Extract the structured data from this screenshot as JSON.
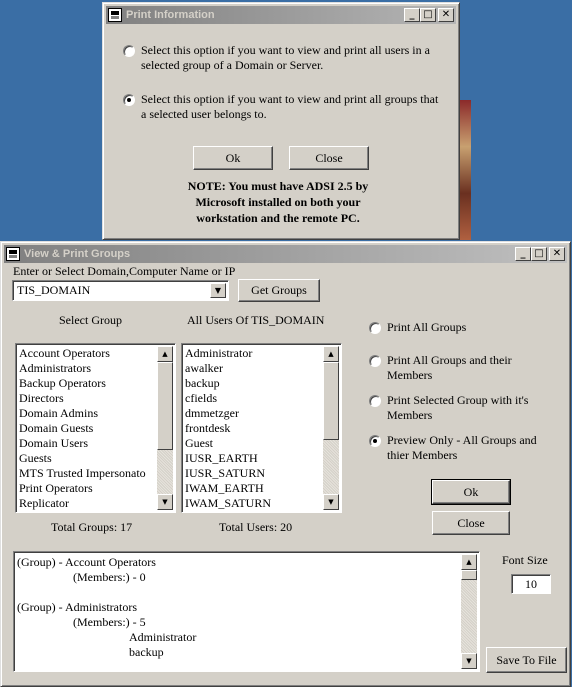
{
  "print_info": {
    "title": "Print Information",
    "option_users": "Select this option if you want to view and print all users in a selected group of a Domain or Server.",
    "option_groups": "Select this option if you want to view and print all groups that a selected user belongs to.",
    "ok_label": "Ok",
    "close_label": "Close",
    "note": "NOTE: You must have ADSI 2.5 by Microsoft installed on both your workstation and the remote PC."
  },
  "main": {
    "title": "View & Print Groups",
    "domain_prompt": "Enter or Select Domain,Computer Name or IP",
    "domain_value": "TIS_DOMAIN",
    "get_groups_label": "Get Groups",
    "select_group_header": "Select Group",
    "all_users_header": "All Users Of TIS_DOMAIN",
    "groups": [
      "Account Operators",
      "Administrators",
      "Backup Operators",
      "Directors",
      "Domain Admins",
      "Domain Guests",
      "Domain Users",
      "Guests",
      "MTS Trusted Impersonato",
      "Print Operators",
      "Replicator"
    ],
    "users": [
      "Administrator",
      "awalker",
      "backup",
      "cfields",
      "dmmetzger",
      "frontdesk",
      "Guest",
      "IUSR_EARTH",
      "IUSR_SATURN",
      "IWAM_EARTH",
      "IWAM_SATURN"
    ],
    "total_groups": "Total Groups: 17",
    "total_users": "Total Users: 20",
    "options": [
      {
        "label": "Print All Groups",
        "checked": false
      },
      {
        "label": "Print All Groups and their Members",
        "checked": false
      },
      {
        "label": "Print Selected Group with it's Members",
        "checked": false
      },
      {
        "label": "Preview Only - All Groups and thier Members",
        "checked": true
      }
    ],
    "ok_label": "Ok",
    "close_label": "Close",
    "font_size_label": "Font Size",
    "font_size_value": "10",
    "save_label": "Save To File",
    "preview_lines": [
      "(Group) - Account Operators",
      "(Members:) - 0",
      "",
      "(Group) - Administrators",
      "(Members:) - 5",
      "Administrator",
      "backup"
    ]
  },
  "colors": {
    "desktop": "#3a6ea5",
    "face": "#d4d0c8"
  }
}
